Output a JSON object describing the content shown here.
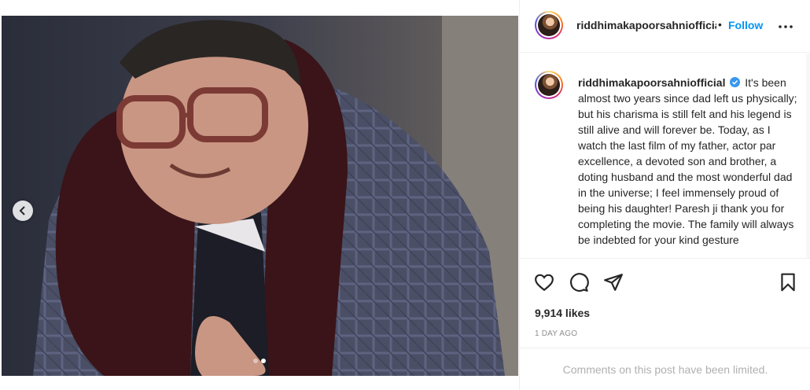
{
  "post": {
    "username": "riddhimakapoorsahniofficial",
    "header_username": "riddhimakapoorsahniofficial",
    "separator": "•",
    "follow_label": "Follow",
    "caption_text": "It's been almost two years since dad left us physically; but his charisma is still felt and his legend is still alive and will forever be. Today, as I watch the last film of my father, actor par excellence, a devoted son and brother, a doting husband and the most wonderful dad in the universe; I feel immensely proud of being his daughter! Paresh ji thank you for completing the movie. The family will always be indebted for your kind gesture",
    "likes": "9,914 likes",
    "timestamp": "1 DAY AGO",
    "comments_limited": "Comments on this post have been limited."
  },
  "carousel": {
    "current_slide": 2,
    "total_slides": 2
  },
  "icons": {
    "prev": "chevron-left-icon",
    "more": "more-horizontal-icon",
    "like": "heart-icon",
    "comment": "comment-icon",
    "share": "send-icon",
    "save": "bookmark-icon",
    "verified": "verified-badge-icon"
  },
  "colors": {
    "accent": "#0095f6",
    "verified": "#3897f0",
    "muted": "#8e8e8e",
    "text": "#262626"
  }
}
